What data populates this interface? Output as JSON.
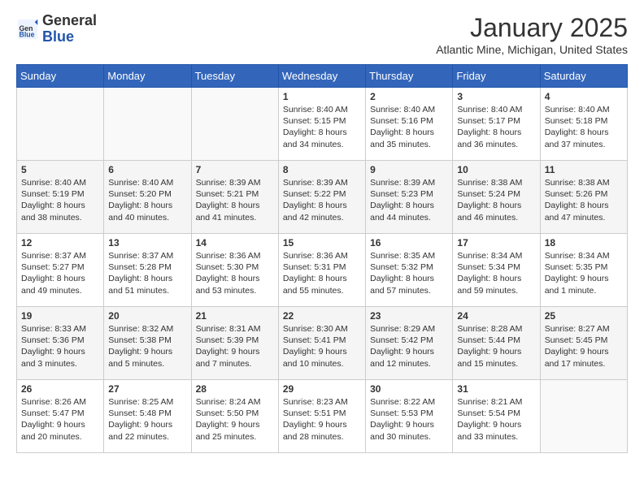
{
  "header": {
    "logo_general": "General",
    "logo_blue": "Blue",
    "month_title": "January 2025",
    "location": "Atlantic Mine, Michigan, United States"
  },
  "weekdays": [
    "Sunday",
    "Monday",
    "Tuesday",
    "Wednesday",
    "Thursday",
    "Friday",
    "Saturday"
  ],
  "weeks": [
    [
      {
        "day": "",
        "text": ""
      },
      {
        "day": "",
        "text": ""
      },
      {
        "day": "",
        "text": ""
      },
      {
        "day": "1",
        "text": "Sunrise: 8:40 AM\nSunset: 5:15 PM\nDaylight: 8 hours\nand 34 minutes."
      },
      {
        "day": "2",
        "text": "Sunrise: 8:40 AM\nSunset: 5:16 PM\nDaylight: 8 hours\nand 35 minutes."
      },
      {
        "day": "3",
        "text": "Sunrise: 8:40 AM\nSunset: 5:17 PM\nDaylight: 8 hours\nand 36 minutes."
      },
      {
        "day": "4",
        "text": "Sunrise: 8:40 AM\nSunset: 5:18 PM\nDaylight: 8 hours\nand 37 minutes."
      }
    ],
    [
      {
        "day": "5",
        "text": "Sunrise: 8:40 AM\nSunset: 5:19 PM\nDaylight: 8 hours\nand 38 minutes."
      },
      {
        "day": "6",
        "text": "Sunrise: 8:40 AM\nSunset: 5:20 PM\nDaylight: 8 hours\nand 40 minutes."
      },
      {
        "day": "7",
        "text": "Sunrise: 8:39 AM\nSunset: 5:21 PM\nDaylight: 8 hours\nand 41 minutes."
      },
      {
        "day": "8",
        "text": "Sunrise: 8:39 AM\nSunset: 5:22 PM\nDaylight: 8 hours\nand 42 minutes."
      },
      {
        "day": "9",
        "text": "Sunrise: 8:39 AM\nSunset: 5:23 PM\nDaylight: 8 hours\nand 44 minutes."
      },
      {
        "day": "10",
        "text": "Sunrise: 8:38 AM\nSunset: 5:24 PM\nDaylight: 8 hours\nand 46 minutes."
      },
      {
        "day": "11",
        "text": "Sunrise: 8:38 AM\nSunset: 5:26 PM\nDaylight: 8 hours\nand 47 minutes."
      }
    ],
    [
      {
        "day": "12",
        "text": "Sunrise: 8:37 AM\nSunset: 5:27 PM\nDaylight: 8 hours\nand 49 minutes."
      },
      {
        "day": "13",
        "text": "Sunrise: 8:37 AM\nSunset: 5:28 PM\nDaylight: 8 hours\nand 51 minutes."
      },
      {
        "day": "14",
        "text": "Sunrise: 8:36 AM\nSunset: 5:30 PM\nDaylight: 8 hours\nand 53 minutes."
      },
      {
        "day": "15",
        "text": "Sunrise: 8:36 AM\nSunset: 5:31 PM\nDaylight: 8 hours\nand 55 minutes."
      },
      {
        "day": "16",
        "text": "Sunrise: 8:35 AM\nSunset: 5:32 PM\nDaylight: 8 hours\nand 57 minutes."
      },
      {
        "day": "17",
        "text": "Sunrise: 8:34 AM\nSunset: 5:34 PM\nDaylight: 8 hours\nand 59 minutes."
      },
      {
        "day": "18",
        "text": "Sunrise: 8:34 AM\nSunset: 5:35 PM\nDaylight: 9 hours\nand 1 minute."
      }
    ],
    [
      {
        "day": "19",
        "text": "Sunrise: 8:33 AM\nSunset: 5:36 PM\nDaylight: 9 hours\nand 3 minutes."
      },
      {
        "day": "20",
        "text": "Sunrise: 8:32 AM\nSunset: 5:38 PM\nDaylight: 9 hours\nand 5 minutes."
      },
      {
        "day": "21",
        "text": "Sunrise: 8:31 AM\nSunset: 5:39 PM\nDaylight: 9 hours\nand 7 minutes."
      },
      {
        "day": "22",
        "text": "Sunrise: 8:30 AM\nSunset: 5:41 PM\nDaylight: 9 hours\nand 10 minutes."
      },
      {
        "day": "23",
        "text": "Sunrise: 8:29 AM\nSunset: 5:42 PM\nDaylight: 9 hours\nand 12 minutes."
      },
      {
        "day": "24",
        "text": "Sunrise: 8:28 AM\nSunset: 5:44 PM\nDaylight: 9 hours\nand 15 minutes."
      },
      {
        "day": "25",
        "text": "Sunrise: 8:27 AM\nSunset: 5:45 PM\nDaylight: 9 hours\nand 17 minutes."
      }
    ],
    [
      {
        "day": "26",
        "text": "Sunrise: 8:26 AM\nSunset: 5:47 PM\nDaylight: 9 hours\nand 20 minutes."
      },
      {
        "day": "27",
        "text": "Sunrise: 8:25 AM\nSunset: 5:48 PM\nDaylight: 9 hours\nand 22 minutes."
      },
      {
        "day": "28",
        "text": "Sunrise: 8:24 AM\nSunset: 5:50 PM\nDaylight: 9 hours\nand 25 minutes."
      },
      {
        "day": "29",
        "text": "Sunrise: 8:23 AM\nSunset: 5:51 PM\nDaylight: 9 hours\nand 28 minutes."
      },
      {
        "day": "30",
        "text": "Sunrise: 8:22 AM\nSunset: 5:53 PM\nDaylight: 9 hours\nand 30 minutes."
      },
      {
        "day": "31",
        "text": "Sunrise: 8:21 AM\nSunset: 5:54 PM\nDaylight: 9 hours\nand 33 minutes."
      },
      {
        "day": "",
        "text": ""
      }
    ]
  ]
}
